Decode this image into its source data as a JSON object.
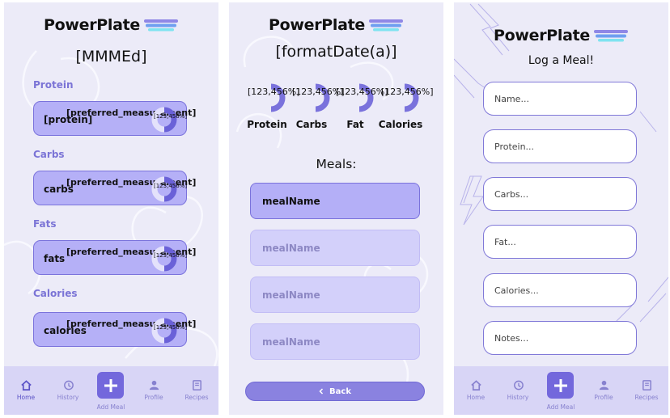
{
  "app": {
    "name": "PowerPlate"
  },
  "home": {
    "title": "[MMMEd]",
    "macros": [
      {
        "section": "Protein",
        "name": "[protein]",
        "pref": "[preferred_measurement]",
        "percent": "[123,456%]"
      },
      {
        "section": "Carbs",
        "name": "carbs",
        "pref": "[preferred_measurement]",
        "percent": "[123,456%]"
      },
      {
        "section": "Fats",
        "name": "fats",
        "pref": "[preferred_measurement]",
        "percent": "[123,456%]"
      },
      {
        "section": "Calories",
        "name": "calories",
        "pref": "[preferred_measurement]",
        "percent": "[123,456%]"
      }
    ]
  },
  "history": {
    "title": "[formatDate(a)]",
    "stats": [
      {
        "value": "[123,456%]",
        "label": "Protein"
      },
      {
        "value": "[123,456%]",
        "label": "Carbs"
      },
      {
        "value": "[123,456%]",
        "label": "Fat"
      },
      {
        "value": "[123,456%]",
        "label": "Calories"
      }
    ],
    "meals_heading": "Meals:",
    "meals": [
      "mealName",
      "mealName",
      "mealName",
      "mealName"
    ],
    "back_label": "Back"
  },
  "log": {
    "title": "Log a Meal!",
    "fields": [
      {
        "placeholder": "Name..."
      },
      {
        "placeholder": "Protein..."
      },
      {
        "placeholder": "Carbs..."
      },
      {
        "placeholder": "Fat..."
      },
      {
        "placeholder": "Calories..."
      },
      {
        "placeholder": "Notes..."
      }
    ]
  },
  "tabbar": {
    "home": "Home",
    "history": "History",
    "add_meal": "Add Meal",
    "profile": "Profile",
    "recipes": "Recipes"
  },
  "icons": [
    "home-icon",
    "history-icon",
    "plus-icon",
    "profile-icon",
    "recipes-icon",
    "chevron-left-icon",
    "plate-logo-icon"
  ],
  "colors": {
    "accent": "#7368dc",
    "card": "#b5b0f7",
    "label": "#7b74d6",
    "background": "#ecebf8"
  }
}
